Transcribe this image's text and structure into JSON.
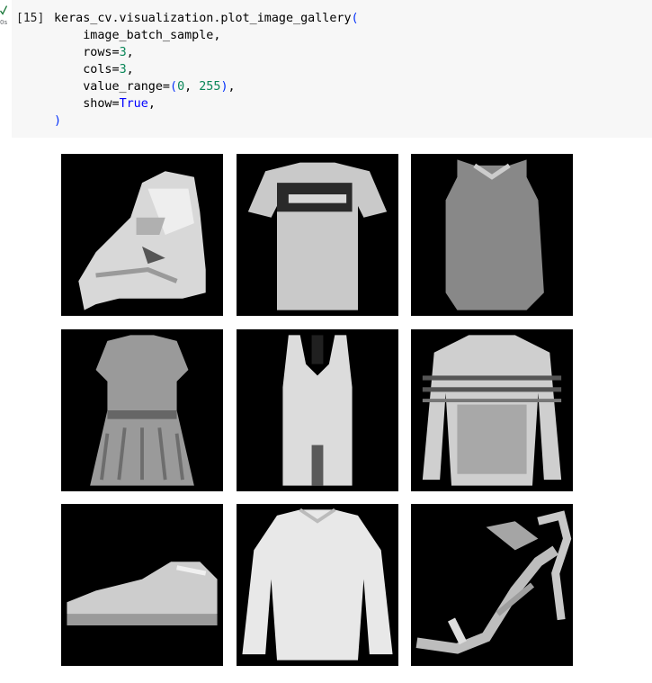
{
  "cell": {
    "execution_count": "[15]",
    "run_time": "0s",
    "code_lines": [
      "keras_cv.visualization.plot_image_gallery(",
      "    image_batch_sample,",
      "    rows=3,",
      "    cols=3,",
      "    value_range=(0, 255),",
      "    show=True,",
      ")"
    ]
  },
  "gallery": {
    "rows": 3,
    "cols": 3,
    "images": [
      {
        "depicts": "ankle-boot"
      },
      {
        "depicts": "t-shirt"
      },
      {
        "depicts": "tank-top"
      },
      {
        "depicts": "dress"
      },
      {
        "depicts": "sleeveless-top"
      },
      {
        "depicts": "pullover"
      },
      {
        "depicts": "sneaker"
      },
      {
        "depicts": "pullover"
      },
      {
        "depicts": "sandal"
      }
    ]
  },
  "colors": {
    "cell_background": "#f7f7f7",
    "number": "#098658",
    "keyword": "#0000ff",
    "image_background": "#000000"
  }
}
